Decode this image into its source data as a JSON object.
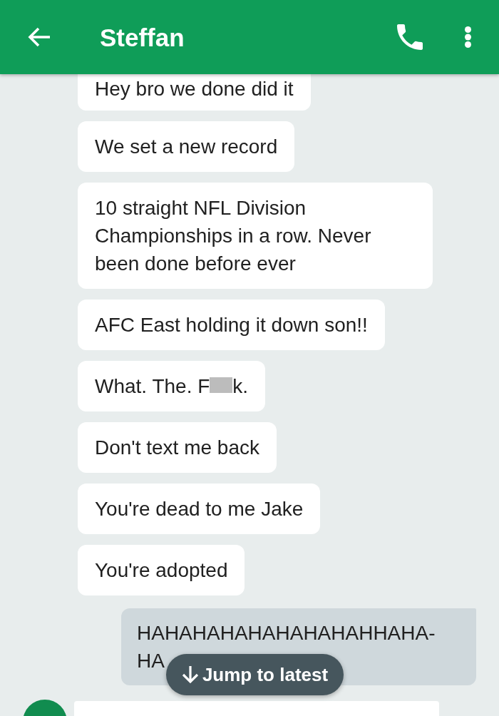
{
  "app_bar": {
    "title": "Steffan"
  },
  "messages": [
    {
      "kind": "received",
      "text": "Hey bro we done did it"
    },
    {
      "kind": "received",
      "text": "We set a new record"
    },
    {
      "kind": "received",
      "text": "10 straight NFL Division Championships in a row. Never been done before ever"
    },
    {
      "kind": "received",
      "text": "AFC East holding it down son!!"
    },
    {
      "kind": "received",
      "segments": [
        {
          "kind": "text",
          "text": "What. The. F"
        },
        {
          "kind": "redaction"
        },
        {
          "kind": "text",
          "text": "k."
        }
      ]
    },
    {
      "kind": "received",
      "text": "Don't text me back"
    },
    {
      "kind": "received",
      "text": "You're dead to me Jake"
    },
    {
      "kind": "received",
      "text": "You're adopted"
    },
    {
      "kind": "sent",
      "text": "HAHAHAHAHAHAHAHAHHAHA-HA"
    }
  ],
  "jump_button": {
    "label": "Jump to latest"
  }
}
